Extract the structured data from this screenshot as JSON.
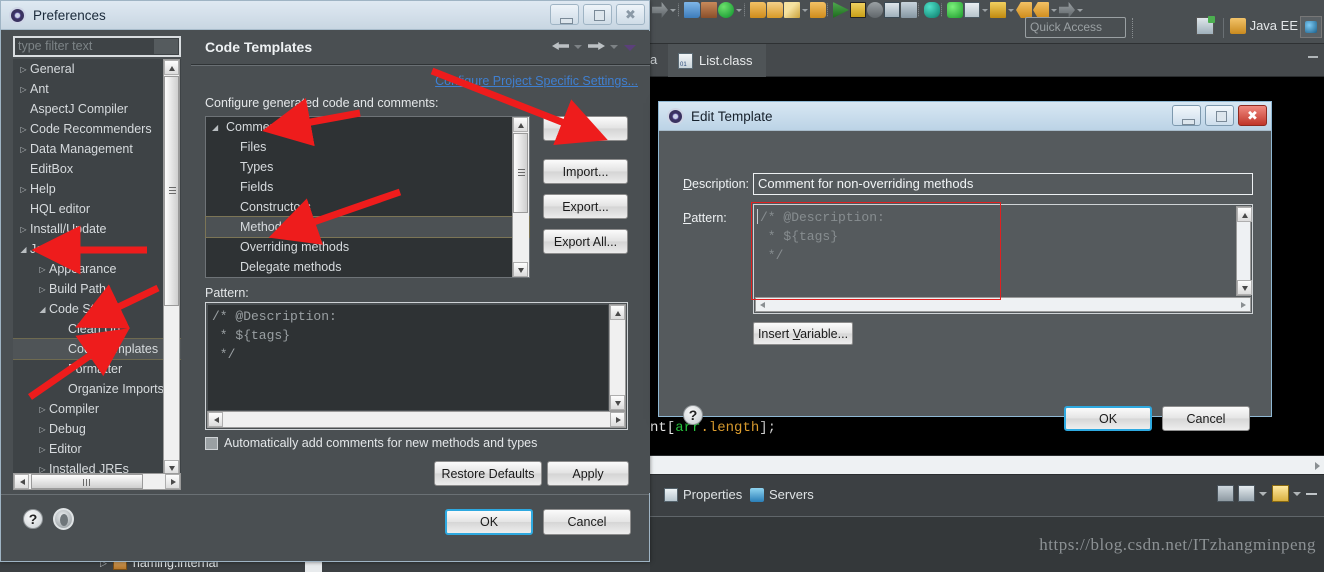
{
  "ide": {
    "quick_access_placeholder": "Quick Access",
    "perspective_label": "Java EE",
    "tab_partial": "a",
    "editor_tab": "List.class",
    "code_snippet": {
      "p1": "nt[",
      "p2": "arr",
      "p3": ".length",
      "p4": "];"
    },
    "views": [
      {
        "label": "Properties",
        "icon": "properties-icon"
      },
      {
        "label": "Servers",
        "icon": "servers-icon"
      }
    ],
    "watermark": "https://blog.csdn.net/ITzhangminpeng",
    "background_tree_item": "naming.internal"
  },
  "preferences": {
    "title": "Preferences",
    "filter_placeholder": "type filter text",
    "tree": [
      {
        "label": "General",
        "arrow": "collapsed",
        "indent": 0,
        "selected": false
      },
      {
        "label": "Ant",
        "arrow": "collapsed",
        "indent": 0,
        "selected": false
      },
      {
        "label": "AspectJ Compiler",
        "arrow": "none",
        "indent": 0,
        "selected": false
      },
      {
        "label": "Code Recommenders",
        "arrow": "collapsed",
        "indent": 0,
        "selected": false
      },
      {
        "label": "Data Management",
        "arrow": "collapsed",
        "indent": 0,
        "selected": false
      },
      {
        "label": "EditBox",
        "arrow": "none",
        "indent": 0,
        "selected": false
      },
      {
        "label": "Help",
        "arrow": "collapsed",
        "indent": 0,
        "selected": false
      },
      {
        "label": "HQL editor",
        "arrow": "none",
        "indent": 0,
        "selected": false
      },
      {
        "label": "Install/Update",
        "arrow": "collapsed",
        "indent": 0,
        "selected": false
      },
      {
        "label": "Java",
        "arrow": "expanded",
        "indent": 0,
        "selected": false
      },
      {
        "label": "Appearance",
        "arrow": "collapsed",
        "indent": 1,
        "selected": false
      },
      {
        "label": "Build Path",
        "arrow": "collapsed",
        "indent": 1,
        "selected": false
      },
      {
        "label": "Code Style",
        "arrow": "expanded",
        "indent": 1,
        "selected": false
      },
      {
        "label": "Clean Up",
        "arrow": "none",
        "indent": 2,
        "selected": false
      },
      {
        "label": "Code Templates",
        "arrow": "none",
        "indent": 2,
        "selected": true
      },
      {
        "label": "Formatter",
        "arrow": "none",
        "indent": 2,
        "selected": false
      },
      {
        "label": "Organize Imports",
        "arrow": "none",
        "indent": 2,
        "selected": false
      },
      {
        "label": "Compiler",
        "arrow": "collapsed",
        "indent": 1,
        "selected": false
      },
      {
        "label": "Debug",
        "arrow": "collapsed",
        "indent": 1,
        "selected": false
      },
      {
        "label": "Editor",
        "arrow": "collapsed",
        "indent": 1,
        "selected": false
      },
      {
        "label": "Installed JREs",
        "arrow": "collapsed",
        "indent": 1,
        "selected": false
      }
    ],
    "page": {
      "title": "Code Templates",
      "project_settings_link": "Configure Project Specific Settings...",
      "configure_label": "Configure generated code and comments:",
      "template_tree": [
        {
          "label": "Comments",
          "arrow": "expanded",
          "sub": false,
          "selected": false
        },
        {
          "label": "Files",
          "arrow": "none",
          "sub": true,
          "selected": false
        },
        {
          "label": "Types",
          "arrow": "none",
          "sub": true,
          "selected": false
        },
        {
          "label": "Fields",
          "arrow": "none",
          "sub": true,
          "selected": false
        },
        {
          "label": "Constructors",
          "arrow": "none",
          "sub": true,
          "selected": false
        },
        {
          "label": "Methods",
          "arrow": "none",
          "sub": true,
          "selected": true
        },
        {
          "label": "Overriding methods",
          "arrow": "none",
          "sub": true,
          "selected": false
        },
        {
          "label": "Delegate methods",
          "arrow": "none",
          "sub": true,
          "selected": false
        }
      ],
      "side_buttons": [
        {
          "label": "Edit..."
        },
        {
          "label": "Import..."
        },
        {
          "label": "Export..."
        },
        {
          "label": "Export All..."
        }
      ],
      "pattern_label": "Pattern:",
      "pattern_text": "/* @Description:\n * ${tags}\n */",
      "auto_comment_label": "Automatically add comments for new methods and types",
      "auto_comment_checked": false,
      "restore_defaults_label": "Restore Defaults",
      "apply_label": "Apply"
    },
    "ok_label": "OK",
    "cancel_label": "Cancel"
  },
  "edit_template": {
    "title": "Edit Template",
    "description_label": "Description:",
    "description_value": "Comment for non-overriding methods",
    "pattern_label": "Pattern:",
    "pattern_value": "/* @Description:\n * ${tags}\n */",
    "insert_variable_label": "Insert Variable...",
    "ok_label": "OK",
    "cancel_label": "Cancel"
  },
  "colors": {
    "accent_link": "#3f7fd0",
    "annotation_red": "#e02020",
    "focus_blue": "#2ea9e0",
    "dialog_bg": "#4a4f52"
  }
}
